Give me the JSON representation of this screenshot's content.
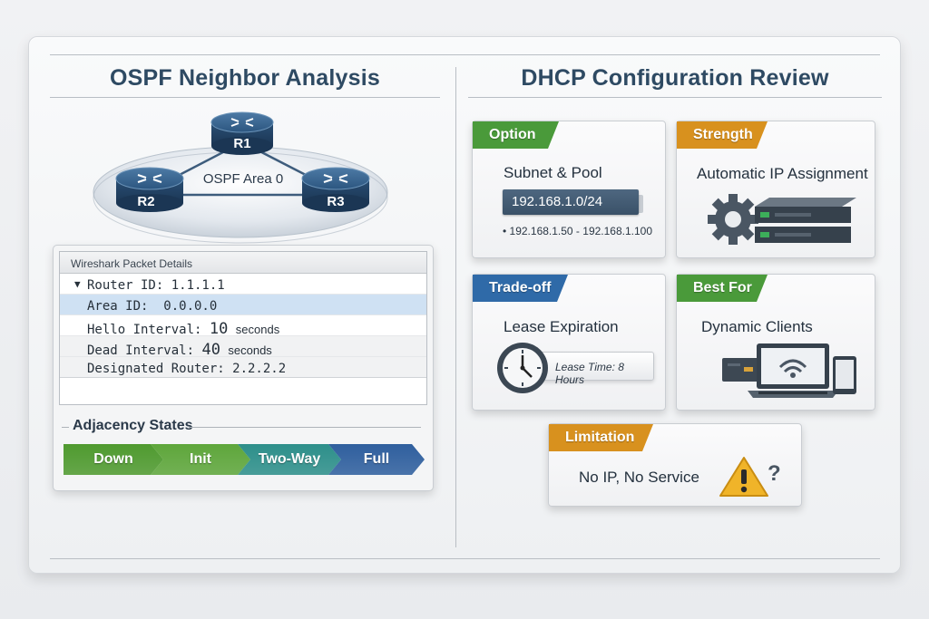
{
  "left_panel": {
    "title": "OSPF Neighbor Analysis",
    "network": {
      "area_label": "OSPF Area 0",
      "routers": [
        "R1",
        "R2",
        "R3"
      ]
    },
    "packet_details": {
      "header": "Wireshark Packet Details",
      "rows": {
        "router_id": "Router ID: 1.1.1.1",
        "area_id": "Area ID:  0.0.0.0",
        "hello_label": "Hello Interval:",
        "hello_value": "10",
        "hello_unit": "seconds",
        "dead_label": "Dead Interval:",
        "dead_value": "40",
        "dead_unit": "seconds",
        "designated_router": "Designated Router: 2.2.2.2"
      }
    },
    "adjacency": {
      "title": "Adjacency States",
      "states": [
        "Down",
        "Init",
        "Two-Way",
        "Full"
      ],
      "colors": [
        "#4f9a2f",
        "#5ea63b",
        "#2d8f8a",
        "#2f5f9e"
      ]
    }
  },
  "right_panel": {
    "title": "DHCP Configuration Review",
    "cards": {
      "option": {
        "tag": "Option",
        "tag_color": "#4a9a3a",
        "title": "Subnet & Pool",
        "subnet": "192.168.1.0/24",
        "pool": "• 192.168.1.50 - 192.168.1.100"
      },
      "strength": {
        "tag": "Strength",
        "tag_color": "#d8911e",
        "title": "Automatic IP Assignment",
        "icons": [
          "gear-icon",
          "server-icon"
        ]
      },
      "tradeoff": {
        "tag": "Trade-off",
        "tag_color": "#2f6aa8",
        "title": "Lease Expiration",
        "lease": "Lease Time: 8 Hours",
        "icons": [
          "clock-icon"
        ]
      },
      "bestfor": {
        "tag": "Best For",
        "tag_color": "#4a9a3a",
        "title": "Dynamic Clients",
        "icons": [
          "desktop-icon",
          "laptop-icon",
          "phone-icon"
        ]
      },
      "limitation": {
        "tag": "Limitation",
        "tag_color": "#d8911e",
        "title": "No IP, No Service",
        "mark": "?",
        "icons": [
          "warning-icon"
        ]
      }
    }
  }
}
